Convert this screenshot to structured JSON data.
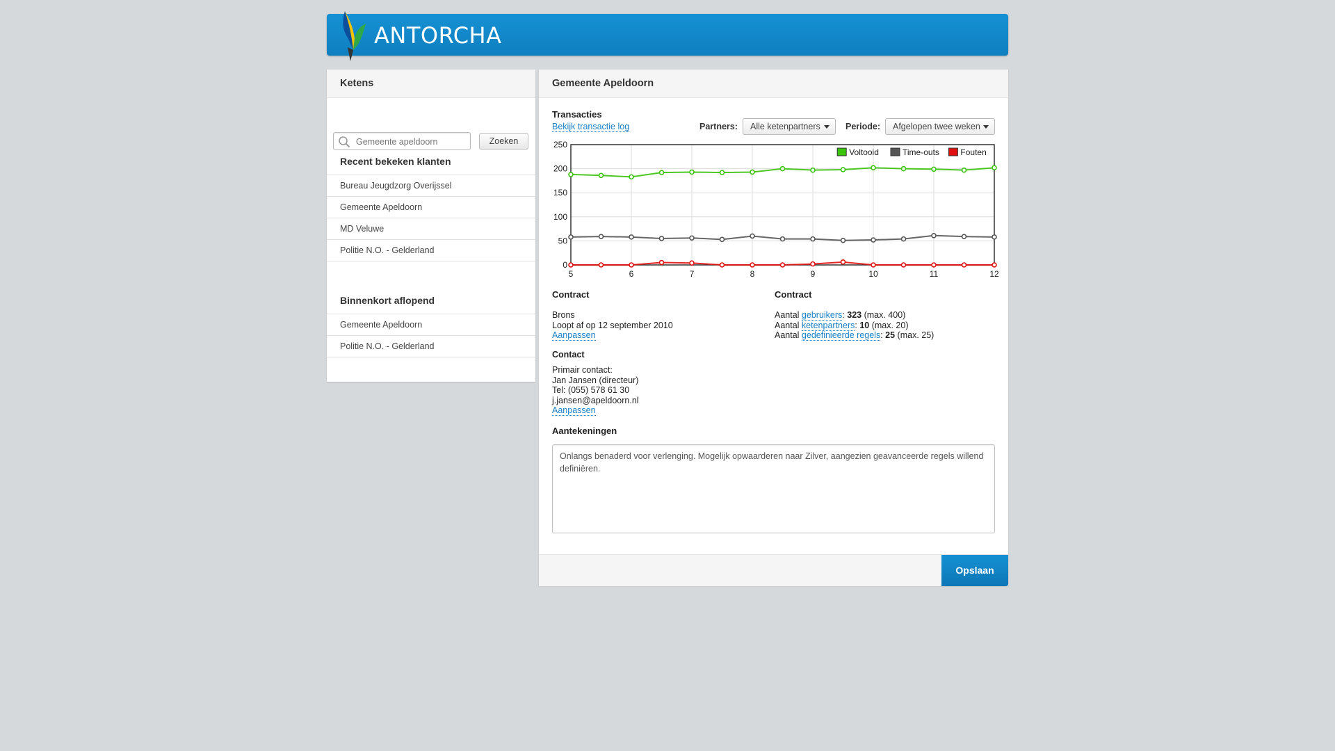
{
  "app": {
    "logo_text": "ANTORCHA"
  },
  "sidebar": {
    "title": "Ketens",
    "search": {
      "placeholder": "Gemeente apeldoorn",
      "button": "Zoeken"
    },
    "recent": {
      "title": "Recent bekeken klanten",
      "items": [
        "Bureau Jeugdzorg Overijssel",
        "Gemeente Apeldoorn",
        "MD Veluwe",
        "Politie N.O. - Gelderland"
      ]
    },
    "expiring": {
      "title": "Binnenkort aflopend",
      "items": [
        "Gemeente Apeldoorn",
        "Politie N.O. - Gelderland"
      ]
    }
  },
  "main": {
    "title": "Gemeente Apeldoorn",
    "transactions": {
      "title": "Transacties",
      "log_link": "Bekijk transactie log",
      "partners_label": "Partners:",
      "partners_value": "Alle ketenpartners",
      "period_label": "Periode:",
      "period_value": "Afgelopen twee weken"
    },
    "contract_left": {
      "title": "Contract",
      "level": "Brons",
      "expires": "Loopt af op 12 september 2010",
      "edit": "Aanpassen"
    },
    "contract_right": {
      "title": "Contract",
      "rows": [
        {
          "prefix": "Aantal ",
          "link": "gebruikers",
          "sep": ": ",
          "value": "323",
          "max": " (max. 400)"
        },
        {
          "prefix": "Aantal ",
          "link": "ketenpartners",
          "sep": ": ",
          "value": "10",
          "max": " (max. 20)"
        },
        {
          "prefix": "Aantal ",
          "link": "gedefinieerde regels",
          "sep": ": ",
          "value": "25",
          "max": " (max. 25)"
        }
      ]
    },
    "contact": {
      "title": "Contact",
      "primary_label": "Primair contact:",
      "name": "Jan Jansen (directeur)",
      "phone": "Tel: (055) 578 61 30",
      "email": "j.jansen@apeldoorn.nl",
      "edit": "Aanpassen"
    },
    "notes": {
      "title": "Aantekeningen",
      "text": "Onlangs benaderd voor verlenging. Mogelijk opwaarderen naar Zilver, aangezien geavanceerde regels willend definiëren."
    },
    "save_button": "Opslaan"
  },
  "colors": {
    "accent": "#1289cc",
    "voltooid": "#3ac20c",
    "timeouts": "#555555",
    "fouten": "#e01010"
  },
  "chart_data": {
    "type": "line",
    "x": [
      5,
      5.5,
      6,
      6.5,
      7,
      7.5,
      8,
      8.5,
      9,
      9.5,
      10,
      10.5,
      11,
      11.5,
      12
    ],
    "xticks": [
      5,
      6,
      7,
      8,
      9,
      10,
      11,
      12
    ],
    "ylim": [
      0,
      250
    ],
    "yticks": [
      0,
      50,
      100,
      150,
      200,
      250
    ],
    "grid": true,
    "legend": "top-right",
    "series": [
      {
        "name": "Voltooid",
        "color": "#3ac20c",
        "values": [
          188,
          186,
          183,
          192,
          193,
          192,
          193,
          200,
          197,
          198,
          202,
          200,
          199,
          197,
          202
        ]
      },
      {
        "name": "Time-outs",
        "color": "#555555",
        "values": [
          58,
          59,
          58,
          55,
          56,
          53,
          60,
          54,
          54,
          51,
          52,
          54,
          61,
          59,
          58
        ]
      },
      {
        "name": "Fouten",
        "color": "#e01010",
        "values": [
          0,
          0,
          0,
          5,
          4,
          0,
          0,
          0,
          2,
          6,
          0,
          0,
          0,
          0,
          0
        ]
      }
    ]
  }
}
